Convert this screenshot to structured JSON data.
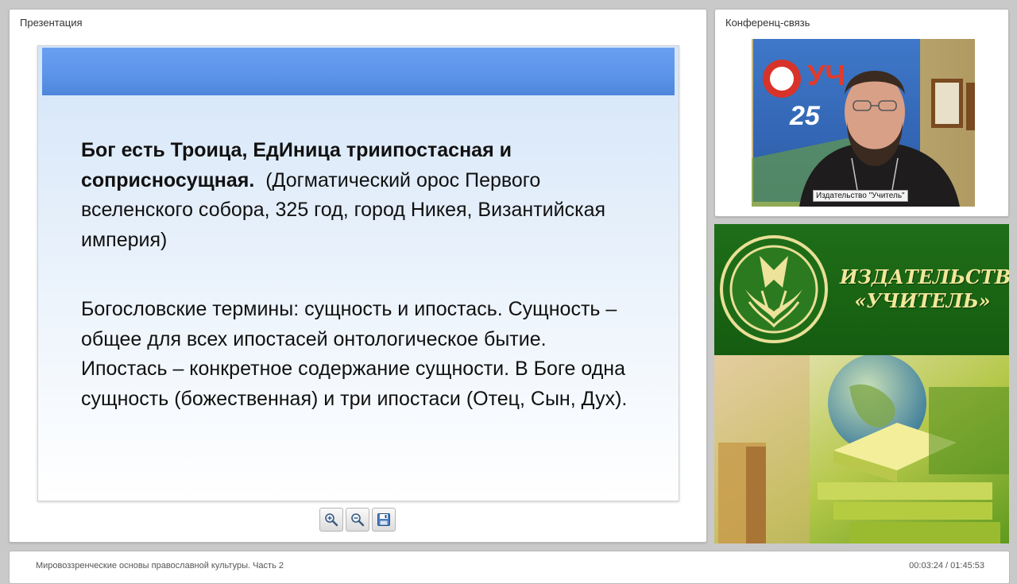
{
  "presentation": {
    "panel_title": "Презентация",
    "slide": {
      "para1_bold": "Бог есть Троица, ЕдИница триипостасная и соприсносущная.",
      "para1_rest": "  (Догматический орос Первого вселенского собора, 325 год, город Никея, Византийская империя)",
      "para2": "Богословские термины: сущность и ипостась. Сущность – общее для всех ипостасей онтологическое бытие. Ипостась – конкретное содержание сущности. В Боге одна сущность (божественная) и три ипостаси (Отец, Сын, Дух)."
    },
    "toolbar": {
      "zoom_in_icon": "zoom-in-icon",
      "zoom_out_icon": "zoom-out-icon",
      "save_icon": "floppy-disk-icon"
    }
  },
  "conference": {
    "panel_title": "Конференц-связь",
    "video_caption": "Издательство \"Учитель\""
  },
  "publisher": {
    "name_line1": "ИЗДАТЕЛЬСТВО",
    "name_line2": "«УЧИТЕЛЬ»"
  },
  "footer": {
    "title": "Мировоззренческие основы православной культуры. Часть 2",
    "time_current": "00:03:24",
    "time_separator": " / ",
    "time_total": "01:45:53"
  },
  "colors": {
    "slide_header_blue": "#5d95ea",
    "banner_green": "#1a6614",
    "banner_text_gold": "#f2e79a"
  }
}
